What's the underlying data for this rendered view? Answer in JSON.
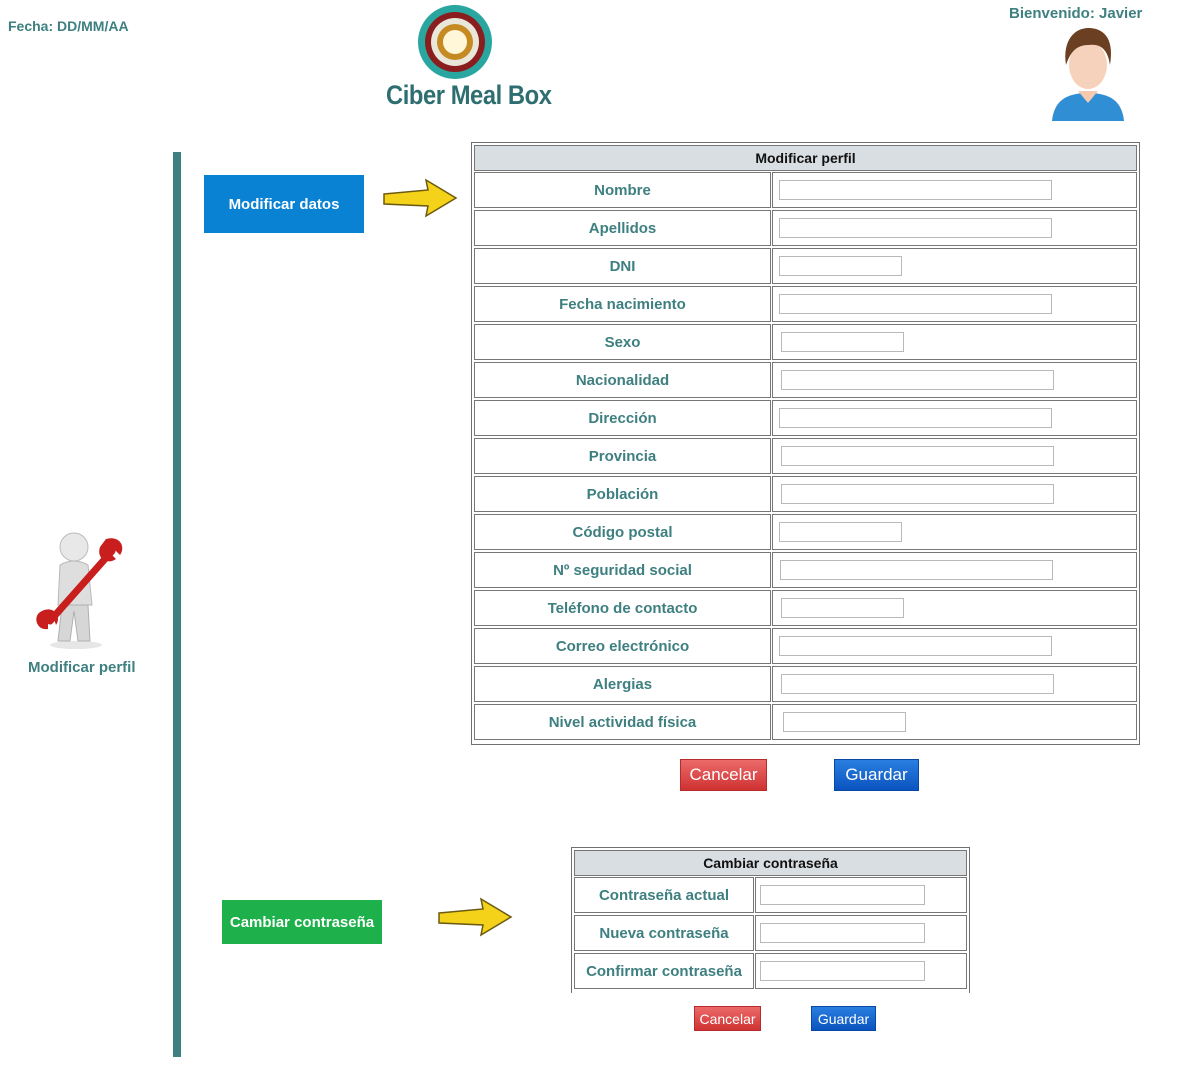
{
  "header": {
    "date": "Fecha: DD/MM/AA",
    "welcome": "Bienvenido: Javier",
    "logo_text": "Ciber Meal Box"
  },
  "sidebar": {
    "profile_label": "Modificar perfil"
  },
  "nav": {
    "modify_data": "Modificar datos",
    "change_password": "Cambiar contraseña"
  },
  "profile_form": {
    "title": "Modificar perfil",
    "fields": [
      {
        "label": "Nombre",
        "value": ""
      },
      {
        "label": "Apellidos",
        "value": ""
      },
      {
        "label": "DNI",
        "value": ""
      },
      {
        "label": "Fecha nacimiento",
        "value": ""
      },
      {
        "label": "Sexo",
        "value": ""
      },
      {
        "label": "Nacionalidad",
        "value": ""
      },
      {
        "label": "Dirección",
        "value": ""
      },
      {
        "label": "Provincia",
        "value": ""
      },
      {
        "label": "Población",
        "value": ""
      },
      {
        "label": "Código postal",
        "value": ""
      },
      {
        "label": "Nº seguridad social",
        "value": ""
      },
      {
        "label": "Teléfono de contacto",
        "value": ""
      },
      {
        "label": "Correo electrónico",
        "value": ""
      },
      {
        "label": "Alergias",
        "value": ""
      },
      {
        "label": "Nivel actividad física",
        "value": ""
      }
    ],
    "cancel_label": "Cancelar",
    "save_label": "Guardar"
  },
  "password_form": {
    "title": "Cambiar contraseña",
    "fields": [
      {
        "label": "Contraseña actual",
        "value": ""
      },
      {
        "label": "Nueva contraseña",
        "value": ""
      },
      {
        "label": "Confirmar contraseña",
        "value": ""
      }
    ],
    "cancel_label": "Cancelar",
    "save_label": "Guardar"
  },
  "colors": {
    "teal": "#3e7f80",
    "blue_nav": "#0a82d4",
    "green_nav": "#1eb04b",
    "cancel_red": "#d83b3b",
    "save_blue": "#0b53bf"
  }
}
